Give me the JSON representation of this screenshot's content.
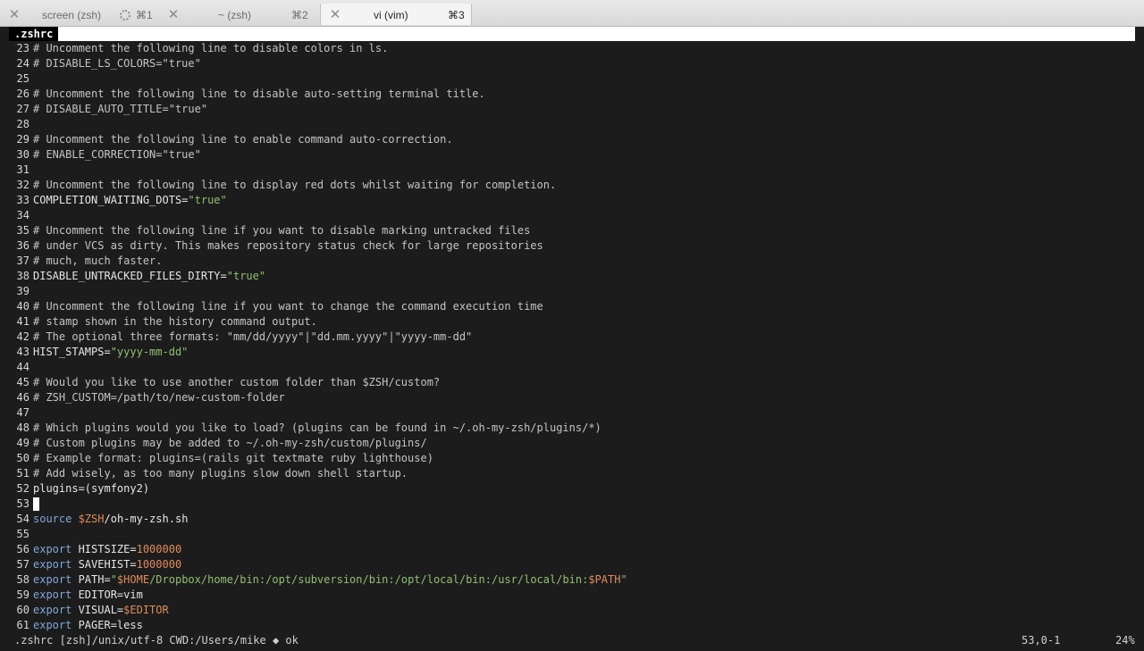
{
  "tabs": [
    {
      "title": "screen (zsh)",
      "shortcut": "⌘1",
      "spinner": true
    },
    {
      "title": "~ (zsh)",
      "shortcut": "⌘2",
      "spinner": false
    },
    {
      "title": "vi (vim)",
      "shortcut": "⌘3",
      "spinner": false
    }
  ],
  "buffer": {
    "name": ".zshrc"
  },
  "lines": [
    {
      "n": "23",
      "segs": [
        {
          "c": "cmt",
          "t": "# Uncomment the following line to disable colors in ls."
        }
      ]
    },
    {
      "n": "24",
      "segs": [
        {
          "c": "cmt",
          "t": "# DISABLE_LS_COLORS=\"true\""
        }
      ]
    },
    {
      "n": "25",
      "segs": []
    },
    {
      "n": "26",
      "segs": [
        {
          "c": "cmt",
          "t": "# Uncomment the following line to disable auto-setting terminal title."
        }
      ]
    },
    {
      "n": "27",
      "segs": [
        {
          "c": "cmt",
          "t": "# DISABLE_AUTO_TITLE=\"true\""
        }
      ]
    },
    {
      "n": "28",
      "segs": []
    },
    {
      "n": "29",
      "segs": [
        {
          "c": "cmt",
          "t": "# Uncomment the following line to enable command auto-correction."
        }
      ]
    },
    {
      "n": "30",
      "segs": [
        {
          "c": "cmt",
          "t": "# ENABLE_CORRECTION=\"true\""
        }
      ]
    },
    {
      "n": "31",
      "segs": []
    },
    {
      "n": "32",
      "segs": [
        {
          "c": "cmt",
          "t": "# Uncomment the following line to display red dots whilst waiting for completion."
        }
      ]
    },
    {
      "n": "33",
      "segs": [
        {
          "c": "txt",
          "t": "COMPLETION_WAITING_DOTS="
        },
        {
          "c": "str",
          "t": "\"true\""
        }
      ]
    },
    {
      "n": "34",
      "segs": []
    },
    {
      "n": "35",
      "segs": [
        {
          "c": "cmt",
          "t": "# Uncomment the following line if you want to disable marking untracked files"
        }
      ]
    },
    {
      "n": "36",
      "segs": [
        {
          "c": "cmt",
          "t": "# under VCS as dirty. This makes repository status check for large repositories"
        }
      ]
    },
    {
      "n": "37",
      "segs": [
        {
          "c": "cmt",
          "t": "# much, much faster."
        }
      ]
    },
    {
      "n": "38",
      "segs": [
        {
          "c": "txt",
          "t": "DISABLE_UNTRACKED_FILES_DIRTY="
        },
        {
          "c": "str",
          "t": "\"true\""
        }
      ]
    },
    {
      "n": "39",
      "segs": []
    },
    {
      "n": "40",
      "segs": [
        {
          "c": "cmt",
          "t": "# Uncomment the following line if you want to change the command execution time"
        }
      ]
    },
    {
      "n": "41",
      "segs": [
        {
          "c": "cmt",
          "t": "# stamp shown in the history command output."
        }
      ]
    },
    {
      "n": "42",
      "segs": [
        {
          "c": "cmt",
          "t": "# The optional three formats: \"mm/dd/yyyy\"|\"dd.mm.yyyy\"|\"yyyy-mm-dd\""
        }
      ]
    },
    {
      "n": "43",
      "segs": [
        {
          "c": "txt",
          "t": "HIST_STAMPS="
        },
        {
          "c": "str",
          "t": "\"yyyy-mm-dd\""
        }
      ]
    },
    {
      "n": "44",
      "segs": []
    },
    {
      "n": "45",
      "segs": [
        {
          "c": "cmt",
          "t": "# Would you like to use another custom folder than $ZSH/custom?"
        }
      ]
    },
    {
      "n": "46",
      "segs": [
        {
          "c": "cmt",
          "t": "# ZSH_CUSTOM=/path/to/new-custom-folder"
        }
      ]
    },
    {
      "n": "47",
      "segs": []
    },
    {
      "n": "48",
      "segs": [
        {
          "c": "cmt",
          "t": "# Which plugins would you like to load? (plugins can be found in ~/.oh-my-zsh/plugins/*)"
        }
      ]
    },
    {
      "n": "49",
      "segs": [
        {
          "c": "cmt",
          "t": "# Custom plugins may be added to ~/.oh-my-zsh/custom/plugins/"
        }
      ]
    },
    {
      "n": "50",
      "segs": [
        {
          "c": "cmt",
          "t": "# Example format: plugins=(rails git textmate ruby lighthouse)"
        }
      ]
    },
    {
      "n": "51",
      "segs": [
        {
          "c": "cmt",
          "t": "# Add wisely, as too many plugins slow down shell startup."
        }
      ]
    },
    {
      "n": "52",
      "segs": [
        {
          "c": "txt",
          "t": "plugins=(symfony2)"
        }
      ]
    },
    {
      "n": "53",
      "segs": [],
      "cursor": true
    },
    {
      "n": "54",
      "segs": [
        {
          "c": "kw",
          "t": "source"
        },
        {
          "c": "txt",
          "t": " "
        },
        {
          "c": "var",
          "t": "$ZSH"
        },
        {
          "c": "txt",
          "t": "/oh-my-zsh.sh"
        }
      ]
    },
    {
      "n": "55",
      "segs": []
    },
    {
      "n": "56",
      "segs": [
        {
          "c": "kw",
          "t": "export"
        },
        {
          "c": "txt",
          "t": " HISTSIZE="
        },
        {
          "c": "num",
          "t": "1000000"
        }
      ]
    },
    {
      "n": "57",
      "segs": [
        {
          "c": "kw",
          "t": "export"
        },
        {
          "c": "txt",
          "t": " SAVEHIST="
        },
        {
          "c": "num",
          "t": "1000000"
        }
      ]
    },
    {
      "n": "58",
      "segs": [
        {
          "c": "kw",
          "t": "export"
        },
        {
          "c": "txt",
          "t": " PATH="
        },
        {
          "c": "str",
          "t": "\""
        },
        {
          "c": "var",
          "t": "$HOME"
        },
        {
          "c": "str",
          "t": "/Dropbox/home/bin:/opt/subversion/bin:/opt/local/bin:/usr/local/bin:"
        },
        {
          "c": "var",
          "t": "$PATH"
        },
        {
          "c": "str",
          "t": "\""
        }
      ]
    },
    {
      "n": "59",
      "segs": [
        {
          "c": "kw",
          "t": "export"
        },
        {
          "c": "txt",
          "t": " EDITOR=vim"
        }
      ]
    },
    {
      "n": "60",
      "segs": [
        {
          "c": "kw",
          "t": "export"
        },
        {
          "c": "txt",
          "t": " VISUAL="
        },
        {
          "c": "var",
          "t": "$EDITOR"
        }
      ]
    },
    {
      "n": "61",
      "segs": [
        {
          "c": "kw",
          "t": "export"
        },
        {
          "c": "txt",
          "t": " PAGER=less"
        }
      ]
    }
  ],
  "status": {
    "left": ".zshrc [zsh]/unix/utf-8 CWD:/Users/mike ◆ ok",
    "position": "53,0-1",
    "percent": "24%"
  }
}
